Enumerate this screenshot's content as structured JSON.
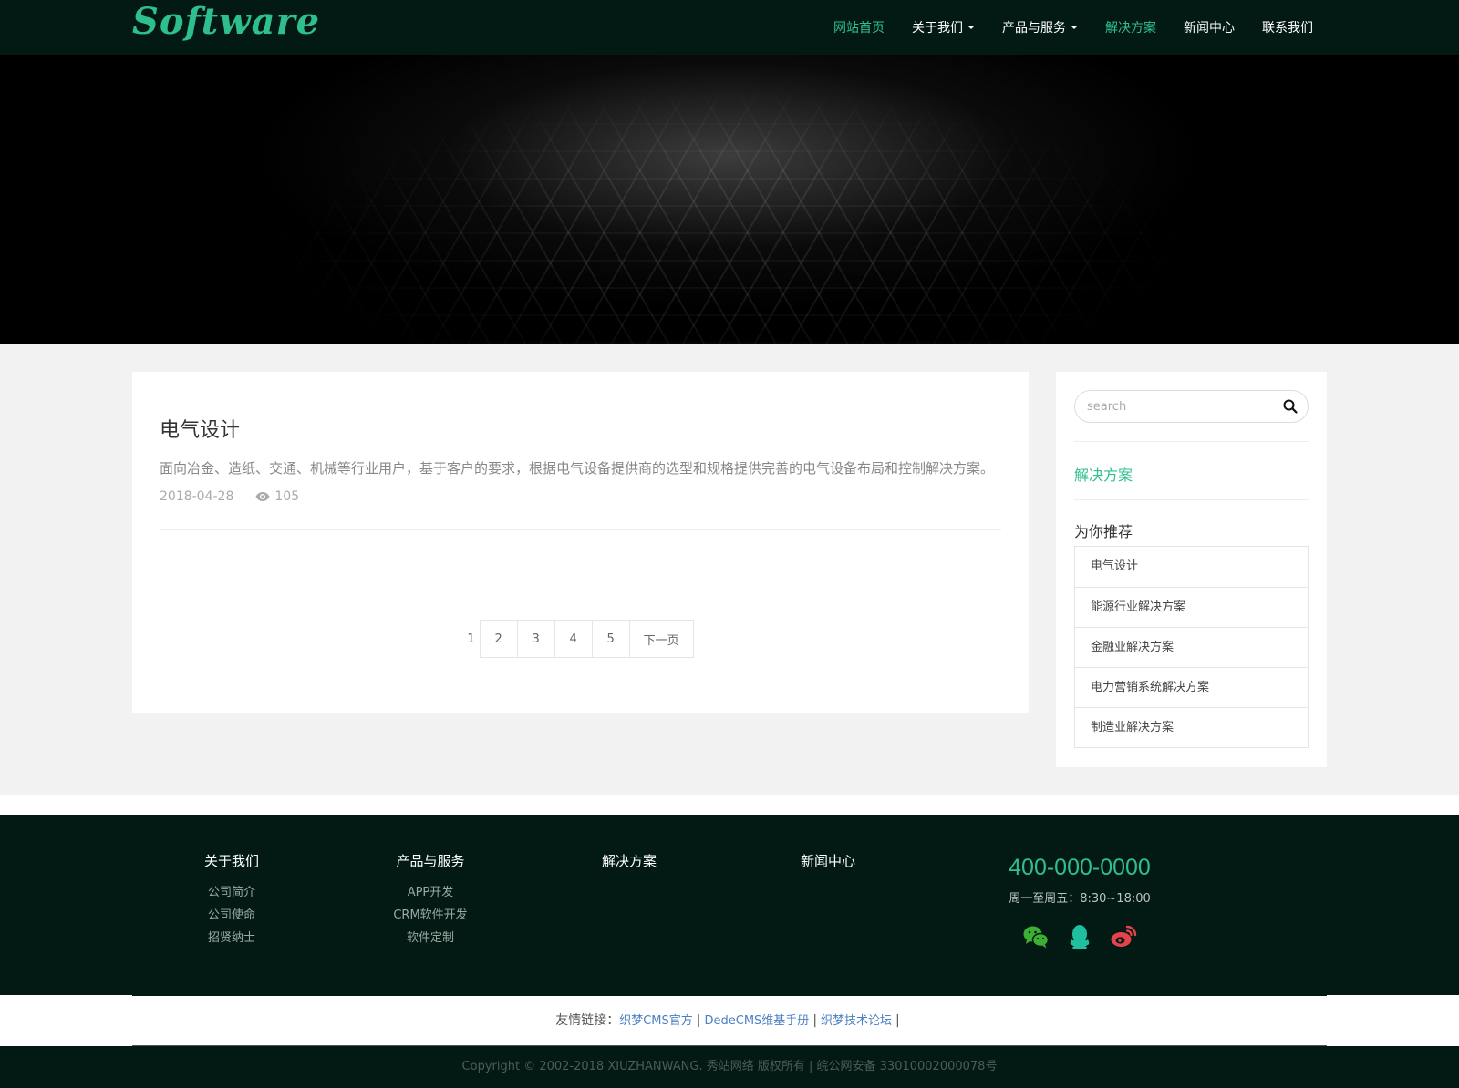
{
  "header": {
    "logo": "Software",
    "nav": [
      {
        "label": "网站首页",
        "active": true,
        "dropdown": false
      },
      {
        "label": "关于我们",
        "active": false,
        "dropdown": true
      },
      {
        "label": "产品与服务",
        "active": false,
        "dropdown": true
      },
      {
        "label": "解决方案",
        "active": true,
        "dropdown": false
      },
      {
        "label": "新闻中心",
        "active": false,
        "dropdown": false
      },
      {
        "label": "联系我们",
        "active": false,
        "dropdown": false
      }
    ]
  },
  "article": {
    "title": "电气设计",
    "description": "面向冶金、造纸、交通、机械等行业用户，基于客户的要求，根据电气设备提供商的选型和规格提供完善的电气设备布局和控制解决方案。",
    "date": "2018-04-28",
    "views": "105",
    "views_icon": "eye-icon"
  },
  "pagination": {
    "current": "1",
    "pages": [
      "2",
      "3",
      "4",
      "5"
    ],
    "next_label": "下一页"
  },
  "sidebar": {
    "search_placeholder": "search",
    "search_icon": "search-icon",
    "category": "解决方案",
    "recommend_title": "为你推荐",
    "recommend_items": [
      "电气设计",
      "能源行业解决方案",
      "金融业解决方案",
      "电力营销系统解决方案",
      "制造业解决方案"
    ]
  },
  "footer": {
    "columns": [
      {
        "title": "关于我们",
        "links": [
          "公司简介",
          "公司使命",
          "招贤纳士"
        ]
      },
      {
        "title": "产品与服务",
        "links": [
          "APP开发",
          "CRM软件开发",
          "软件定制"
        ]
      },
      {
        "title": "解决方案",
        "links": []
      },
      {
        "title": "新闻中心",
        "links": []
      }
    ],
    "phone": "400-000-0000",
    "hours": "周一至周五：8:30~18:00",
    "social": [
      {
        "name": "wechat-icon",
        "color": "#3cb034"
      },
      {
        "name": "qq-icon",
        "color": "#1fbfa0"
      },
      {
        "name": "weibo-icon",
        "color": "#e6424b"
      }
    ],
    "friend_links_label": "友情链接：",
    "friend_links": [
      "织梦CMS官方",
      "DedeCMS维基手册",
      "织梦技术论坛"
    ],
    "copyright": "Copyright © 2002-2018 XIUZHANWANG. 秀站网络 版权所有 | 皖公网安备 33010002000078号"
  },
  "colors": {
    "accent": "#2fbf8f",
    "header_bg": "#021a13",
    "link": "#4a80c4"
  }
}
